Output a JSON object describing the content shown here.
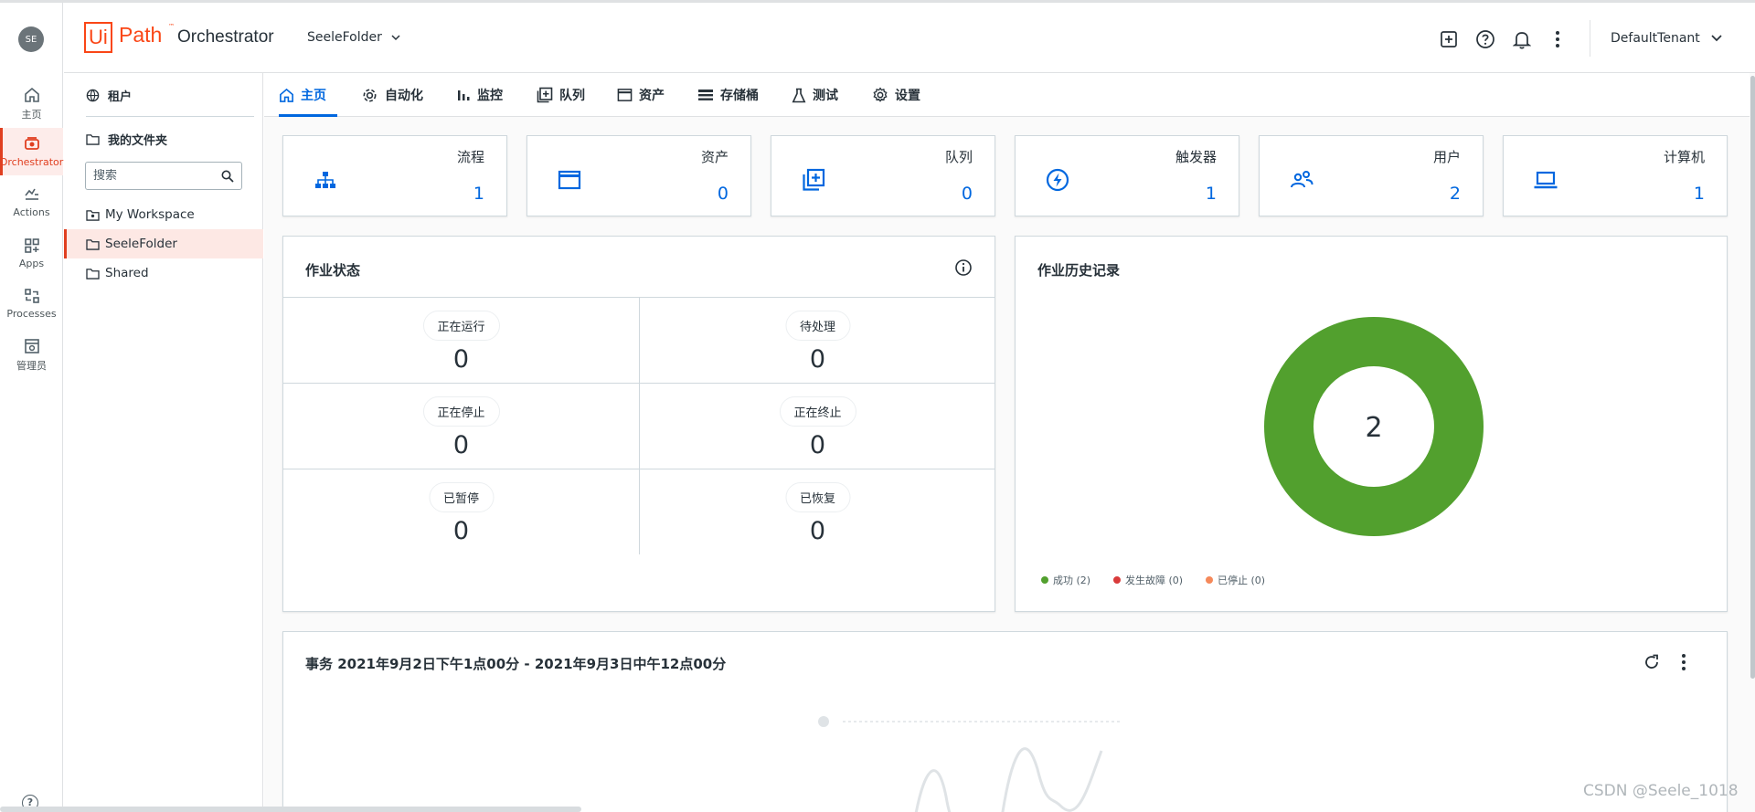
{
  "rail": {
    "avatar": "SE",
    "items": [
      {
        "label": "主页",
        "icon": "home-icon"
      },
      {
        "label": "Orchestrator",
        "icon": "orchestrator-icon"
      },
      {
        "label": "Actions",
        "icon": "actions-icon"
      },
      {
        "label": "Apps",
        "icon": "apps-icon"
      },
      {
        "label": "Processes",
        "icon": "processes-icon"
      },
      {
        "label": "管理员",
        "icon": "admin-icon"
      }
    ]
  },
  "header": {
    "logo_ui": "Ui",
    "logo_path": "Path",
    "logo_tm": "™",
    "product": "Orchestrator",
    "folder": "SeeleFolder",
    "tenant": "DefaultTenant"
  },
  "tree": {
    "tenant_label": "租户",
    "my_folders_label": "我的文件夹",
    "search_placeholder": "搜索",
    "items": [
      "My Workspace",
      "SeeleFolder",
      "Shared"
    ],
    "selected": "SeeleFolder"
  },
  "tabs": [
    "主页",
    "自动化",
    "监控",
    "队列",
    "资产",
    "存储桶",
    "测试",
    "设置"
  ],
  "active_tab": "主页",
  "stats": [
    {
      "label": "流程",
      "value": "1",
      "icon": "processes-hierarchy-icon"
    },
    {
      "label": "资产",
      "value": "0",
      "icon": "asset-window-icon"
    },
    {
      "label": "队列",
      "value": "0",
      "icon": "queue-icon"
    },
    {
      "label": "触发器",
      "value": "1",
      "icon": "trigger-icon"
    },
    {
      "label": "用户",
      "value": "2",
      "icon": "users-icon"
    },
    {
      "label": "计算机",
      "value": "1",
      "icon": "laptop-icon"
    }
  ],
  "job_status": {
    "title": "作业状态",
    "cells": [
      {
        "label": "正在运行",
        "value": "0"
      },
      {
        "label": "待处理",
        "value": "0"
      },
      {
        "label": "正在停止",
        "value": "0"
      },
      {
        "label": "正在终止",
        "value": "0"
      },
      {
        "label": "已暂停",
        "value": "0"
      },
      {
        "label": "已恢复",
        "value": "0"
      }
    ]
  },
  "job_history": {
    "title": "作业历史记录",
    "total": "2",
    "legend": [
      {
        "label": "成功 (2)",
        "color": "#52a02e"
      },
      {
        "label": "发生故障 (0)",
        "color": "#d93b3b"
      },
      {
        "label": "已停止 (0)",
        "color": "#f5895a"
      }
    ]
  },
  "chart_data": {
    "type": "pie",
    "categories": [
      "成功",
      "发生故障",
      "已停止"
    ],
    "values": [
      2,
      0,
      0
    ],
    "center_label": "2"
  },
  "transactions": {
    "title": "事务 2021年9月2日下午1点00分 - 2021年9月3日中午12点00分"
  },
  "watermark": "CSDN @Seele_1018",
  "colors": {
    "accent": "#0067df",
    "brand": "#fa4616",
    "success": "#52a02e"
  }
}
